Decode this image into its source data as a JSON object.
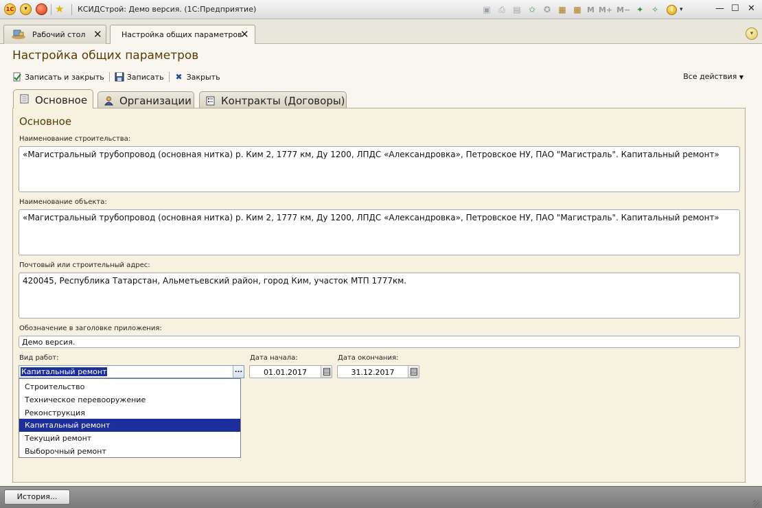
{
  "window": {
    "title": "КСИДСтрой: Демо версия.  (1С:Предприятие)",
    "toolbar_text_buttons": [
      "M",
      "M+",
      "M−"
    ]
  },
  "tabs": [
    {
      "label": "Рабочий стол",
      "icon": "desktop-icon",
      "active": false
    },
    {
      "label": "Настройка общих параметров",
      "active": true
    }
  ],
  "form": {
    "title": "Настройка общих параметров",
    "commands": {
      "save_close": "Записать и закрыть",
      "save": "Записать",
      "close": "Закрыть",
      "all_actions": "Все действия"
    },
    "page_tabs": [
      {
        "label": "Основное",
        "icon": "document-icon",
        "active": true
      },
      {
        "label": "Организации",
        "icon": "person-icon",
        "active": false
      },
      {
        "label": "Контракты (Договоры)",
        "icon": "list-icon",
        "active": false
      }
    ],
    "section_title": "Основное",
    "construction_name": {
      "label": "Наименование строительства:",
      "value": "«Магистральный трубопровод (основная нитка) р. Ким 2, 1777 км, Ду 1200, ЛПДС «Александровка», Петровское НУ, ПАО \"Магистраль\". Капитальный ремонт»"
    },
    "object_name": {
      "label": "Наименование объекта:",
      "value": "«Магистральный трубопровод (основная нитка) р. Ким 2, 1777 км, Ду 1200, ЛПДС «Александровка», Петровское НУ, ПАО \"Магистраль\". Капитальный ремонт»"
    },
    "address": {
      "label": "Почтовый или строительный адрес:",
      "value": "420045, Республика Татарстан, Альметьевский район, город Ким, участок МТП 1777км."
    },
    "app_caption": {
      "label": "Обозначение в заголовке приложения:",
      "value": "Демо версия."
    },
    "work_type": {
      "label": "Вид работ:",
      "value": "Капитальный ремонт",
      "button": "...",
      "options": [
        "Строительство",
        "Техническое перевооружение",
        "Реконструкция",
        "Капитальный ремонт",
        "Текущий ремонт",
        "Выборочный ремонт"
      ],
      "selected_index": 3
    },
    "start_date": {
      "label": "Дата начала:",
      "value": "01.01.2017"
    },
    "end_date": {
      "label": "Дата окончания:",
      "value": "31.12.2017"
    }
  },
  "bottom": {
    "history_button": "История..."
  },
  "colors": {
    "accent_title": "#5a3a00",
    "selection": "#1d2f9c",
    "panel_bg": "#f6f2df"
  }
}
